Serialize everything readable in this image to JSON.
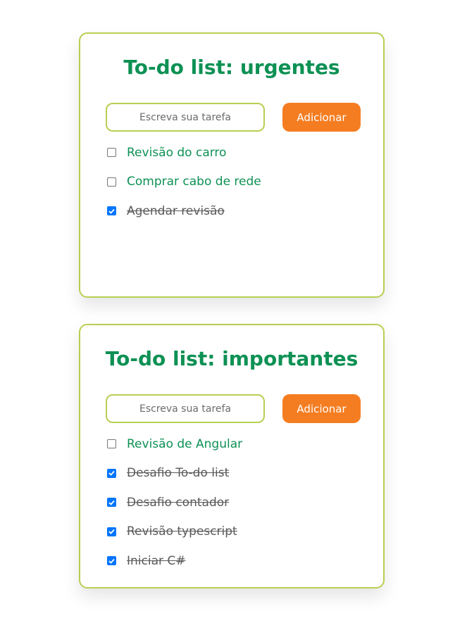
{
  "lists": [
    {
      "title": "To-do list: urgentes",
      "input_placeholder": "Escreva sua tarefa",
      "add_label": "Adicionar",
      "tasks": [
        {
          "label": "Revisão do carro",
          "done": false
        },
        {
          "label": "Comprar cabo de rede",
          "done": false
        },
        {
          "label": "Agendar revisão",
          "done": true
        }
      ]
    },
    {
      "title": "To-do list: importantes",
      "input_placeholder": "Escreva sua tarefa",
      "add_label": "Adicionar",
      "tasks": [
        {
          "label": "Revisão de Angular",
          "done": false
        },
        {
          "label": "Desafio To-do list",
          "done": true
        },
        {
          "label": "Desafio contador",
          "done": true
        },
        {
          "label": "Revisão typescript",
          "done": true
        },
        {
          "label": "Iniciar C#",
          "done": true
        }
      ]
    }
  ],
  "colors": {
    "title": "#0d9154",
    "border": "#b7cf52",
    "button": "#f57d21",
    "checkbox_checked": "#0075ff",
    "done_text": "#5a5a5a"
  },
  "icons": {
    "checkbox_check": "check-icon"
  }
}
